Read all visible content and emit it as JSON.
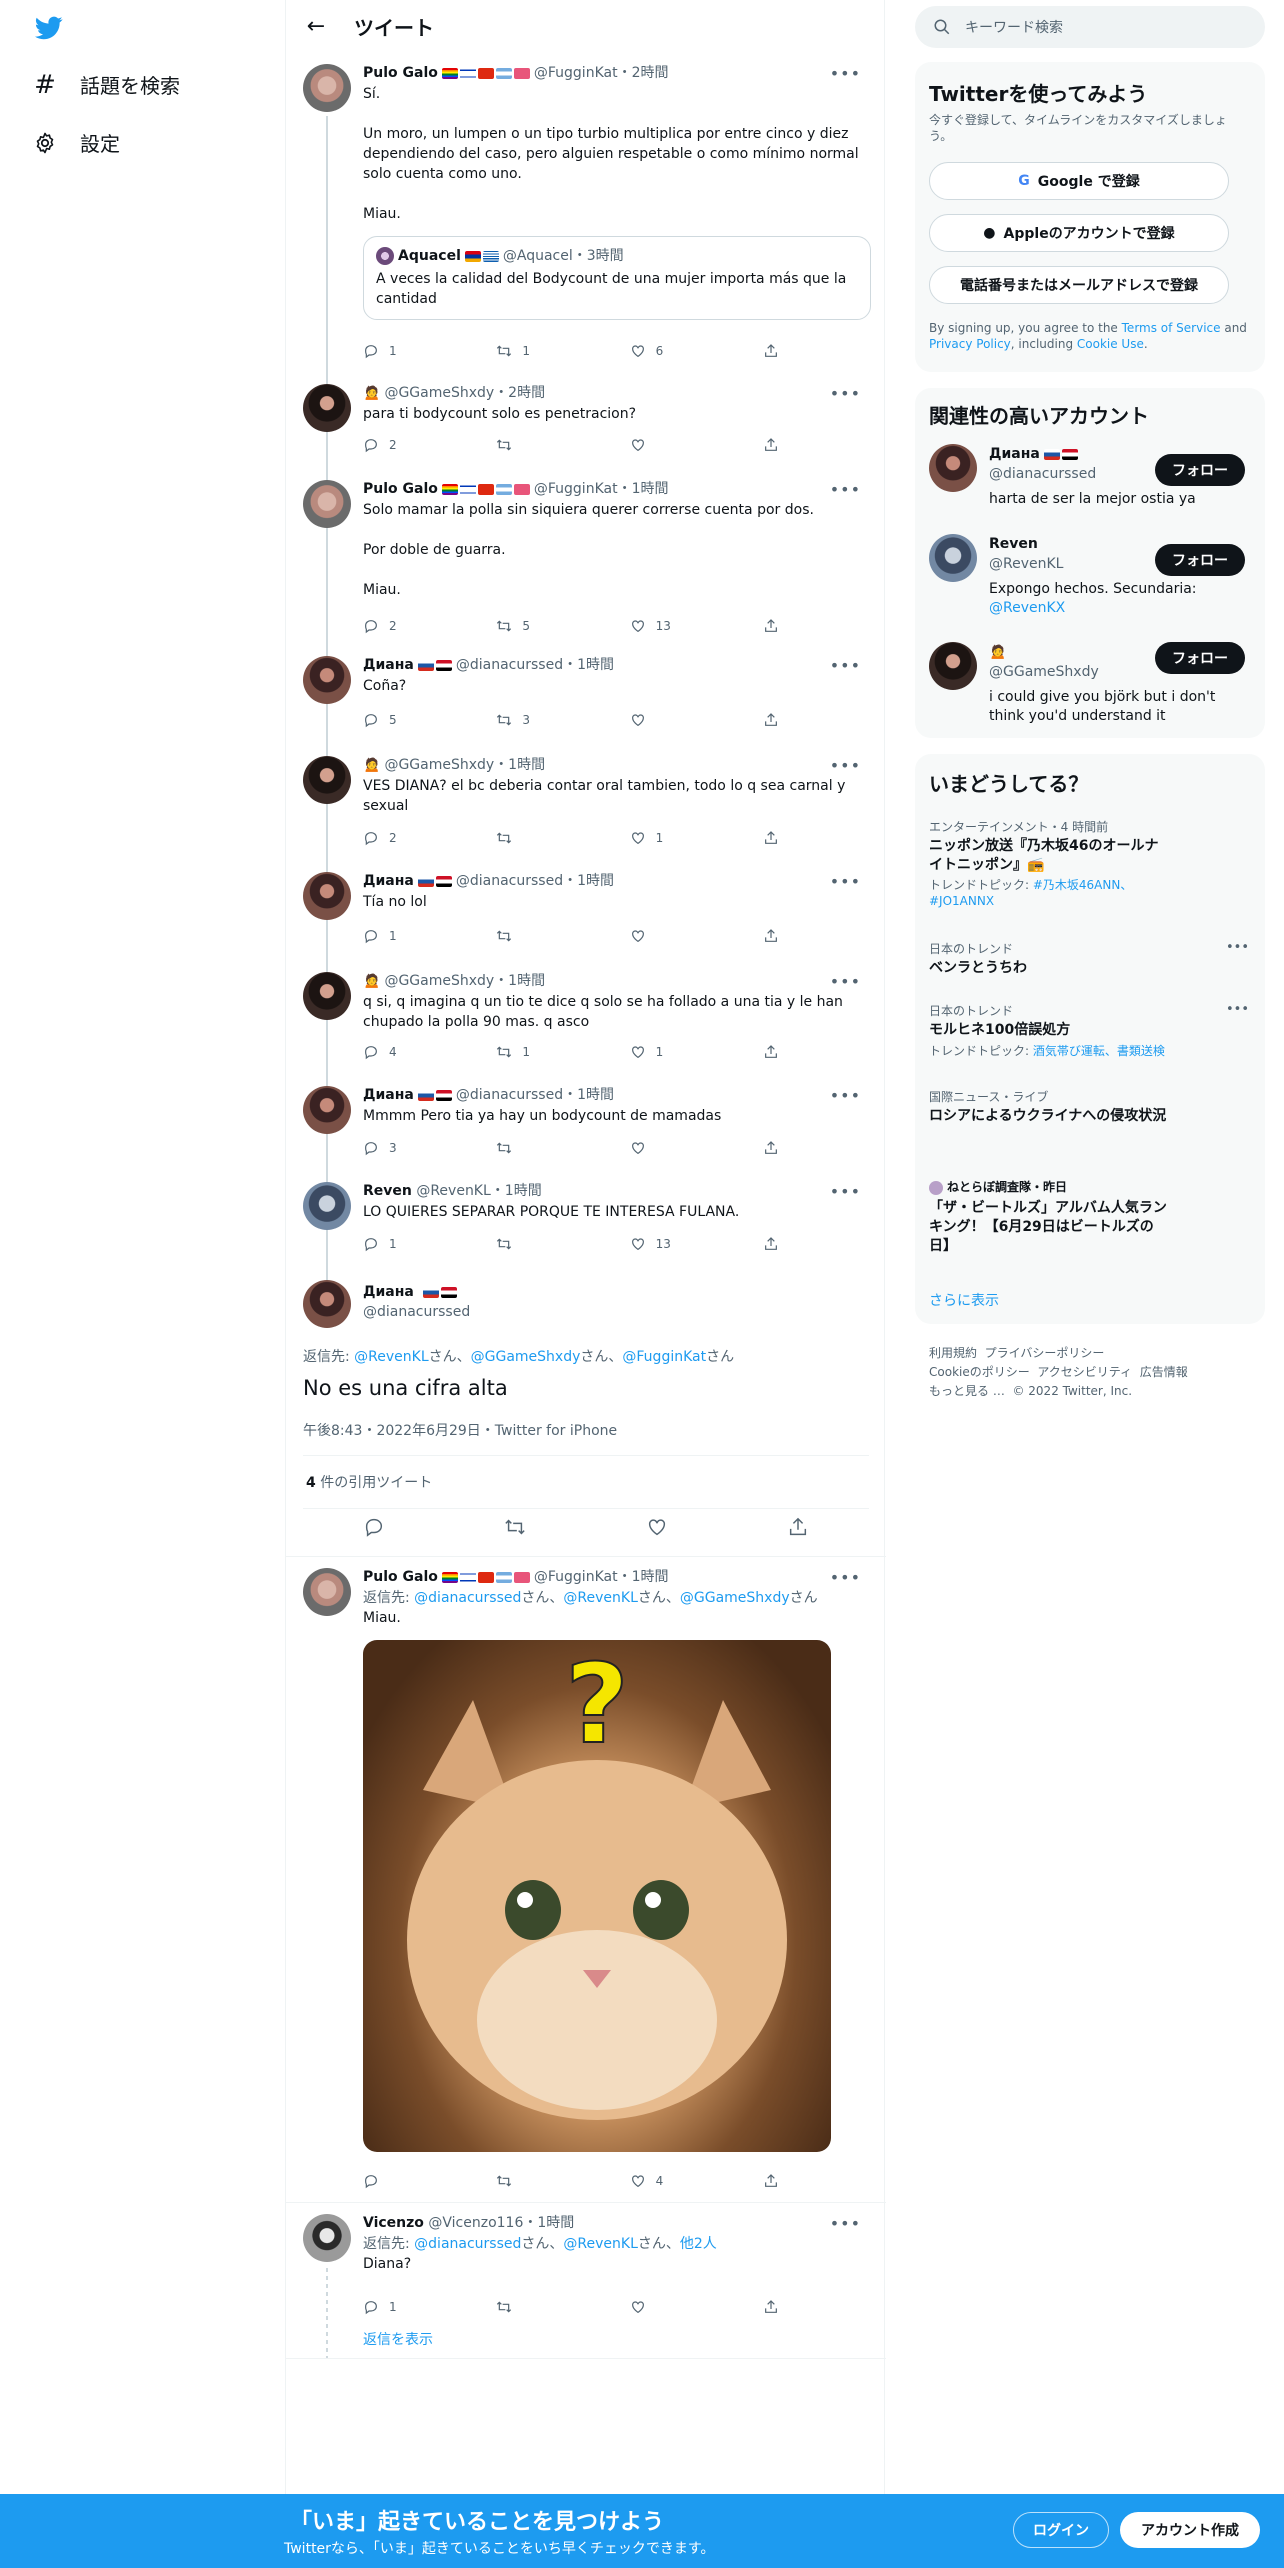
{
  "nav": {
    "explore": "話題を検索",
    "settings": "設定"
  },
  "header": {
    "title": "ツイート"
  },
  "search": {
    "placeholder": "キーワード検索"
  },
  "tweets": [
    {
      "name": "Pulo Galo",
      "handle": "@FugginKat",
      "time": "・2時間",
      "text": "Sí.\n\nUn moro, un lumpen o un tipo turbio multiplica por entre cinco y diez dependiendo del caso, pero alguien respetable o como mínimo normal solo cuenta como uno.\n\nMiau.",
      "reply": "1",
      "rt": "1",
      "like": "6"
    },
    {
      "name": "",
      "handle": "@GGameShxdy",
      "time": "・2時間",
      "text": "para ti bodycount solo es penetracion?",
      "reply": "2",
      "rt": "",
      "like": ""
    },
    {
      "name": "Pulo Galo",
      "handle": "@FugginKat",
      "time": "・1時間",
      "text": "Solo mamar la polla sin siquiera querer correrse cuenta por dos.\n\nPor doble de guarra.\n\nMiau.",
      "reply": "2",
      "rt": "5",
      "like": "13"
    },
    {
      "name": "Диана",
      "handle": "@dianacurssed",
      "time": "・1時間",
      "text": "Coña?",
      "reply": "5",
      "rt": "3",
      "like": ""
    },
    {
      "name": "",
      "handle": "@GGameShxdy",
      "time": "・1時間",
      "text": "VES DIANA? el bc deberia contar oral tambien, todo lo q sea carnal y sexual",
      "reply": "2",
      "rt": "",
      "like": "1"
    },
    {
      "name": "Диана",
      "handle": "@dianacurssed",
      "time": "・1時間",
      "text": "Tía no lol",
      "reply": "1",
      "rt": "",
      "like": ""
    },
    {
      "name": "",
      "handle": "@GGameShxdy",
      "time": "・1時間",
      "text": "q si, q imagina q un tio te dice q solo se ha follado a una tia y le han chupado la polla 90 mas. q asco",
      "reply": "4",
      "rt": "1",
      "like": "1"
    },
    {
      "name": "Диана",
      "handle": "@dianacurssed",
      "time": "・1時間",
      "text": "Mmmm Pero tia ya hay un bodycount de mamadas",
      "reply": "3",
      "rt": "",
      "like": ""
    },
    {
      "name": "Reven",
      "handle": "@RevenKL",
      "time": "・1時間",
      "text": "LO QUIERES SEPARAR PORQUE TE INTERESA FULANA.",
      "reply": "1",
      "rt": "",
      "like": "13"
    }
  ],
  "quote": {
    "name": "Aquacel",
    "handle": "@Aquacel",
    "time": "・3時間",
    "text": "A veces la calidad del Bodycount de una mujer importa más que la cantidad"
  },
  "main_tweet": {
    "name": "Диана",
    "handle": "@dianacurssed",
    "reply_prefix": "返信先: ",
    "reply_to": [
      {
        "handle": "@RevenKL",
        "suffix": "さん、"
      },
      {
        "handle": "@GGameShxdy",
        "suffix": "さん、"
      },
      {
        "handle": "@FugginKat",
        "suffix": "さん"
      }
    ],
    "text": "No es una cifra alta",
    "meta": "午後8:43・2022年6月29日・Twitter for iPhone",
    "quote_count": "4",
    "quote_label": " 件の引用ツイート"
  },
  "replies": [
    {
      "name": "Pulo Galo",
      "handle": "@FugginKat",
      "time": "・1時間",
      "reply_prefix": "返信先: ",
      "reply_to": [
        {
          "handle": "@dianacurssed",
          "suffix": "さん、"
        },
        {
          "handle": "@RevenKL",
          "suffix": "さん、"
        },
        {
          "handle": "@GGameShxdy",
          "suffix": "さん"
        }
      ],
      "text": "Miau.",
      "reply": "",
      "rt": "",
      "like": "4",
      "image_text": "?"
    },
    {
      "name": "Vicenzo",
      "handle": "@Vicenzo116",
      "time": "・1時間",
      "reply_prefix": "返信先: ",
      "reply_to": [
        {
          "handle": "@dianacurssed",
          "suffix": "さん、"
        },
        {
          "handle": "@RevenKL",
          "suffix": "さん、"
        },
        {
          "handle": "他2人",
          "suffix": ""
        }
      ],
      "text": "Diana?",
      "reply": "1",
      "rt": "",
      "like": ""
    }
  ],
  "show_replies": "返信を表示",
  "signup": {
    "title": "Twitterを使ってみよう",
    "subtitle": "今すぐ登録して、タイムラインをカスタマイズしましょう。",
    "google": "Google で登録",
    "apple": "Appleのアカウントで登録",
    "phone": "電話番号またはメールアドレスで登録",
    "legal_1": "By signing up, you agree to the ",
    "tos": "Terms of Service",
    "legal_2": " and ",
    "privacy": "Privacy Policy",
    "legal_3": ", including ",
    "cookie": "Cookie Use",
    "legal_4": "."
  },
  "relevant": {
    "title": "関連性の高いアカウント",
    "follow": "フォロー",
    "accounts": [
      {
        "name": "Диана",
        "handle": "@dianacurssed",
        "bio": "harta de ser la mejor ostia ya",
        "bio_link": ""
      },
      {
        "name": "Reven",
        "handle": "@RevenKL",
        "bio": "Expongo hechos. Secundaria: ",
        "bio_link": "@RevenKX"
      },
      {
        "name": "",
        "handle": "@GGameShxdy",
        "bio": "i could give you björk but i don't think you'd understand it",
        "bio_link": ""
      }
    ]
  },
  "trends": {
    "title": "いまどうしてる？",
    "items": [
      {
        "meta": "エンターテインメント・4 時間前",
        "title": "ニッポン放送『乃木坂46のオールナイトニッポン』📻",
        "sub_prefix": "トレンドトピック: ",
        "sub": "#乃木坂46ANN、#JO1ANNX"
      },
      {
        "meta": "日本のトレンド",
        "title": "ベンラとうちわ",
        "sub_prefix": "",
        "sub": ""
      },
      {
        "meta": "日本のトレンド",
        "title": "モルヒネ100倍誤処方",
        "sub_prefix": "トレンドトピック: ",
        "sub": "酒気帯び運転、書類送検"
      },
      {
        "meta": "国際ニュース・ライブ",
        "title": "ロシアによるウクライナへの侵攻状況",
        "sub_prefix": "",
        "sub": ""
      },
      {
        "meta": "ねとらぼ調査隊・昨日",
        "title": "「ザ・ビートルズ」アルバム人気ランキング！【6月29日はビートルズの日】",
        "sub_prefix": "",
        "sub": ""
      }
    ],
    "more": "さらに表示"
  },
  "footer": {
    "links": [
      "利用規約",
      "プライバシーポリシー",
      "Cookieのポリシー",
      "アクセシビリティ",
      "広告情報",
      "もっと見る …"
    ],
    "copyright": "© 2022 Twitter, Inc."
  },
  "bottom_bar": {
    "title": "「いま」起きていることを見つけよう",
    "subtitle": "Twitterなら、「いま」起きていることをいち早くチェックできます。",
    "login": "ログイン",
    "signup": "アカウント作成"
  },
  "colors": {
    "accent": "#1d9bf0",
    "text": "#0f1419",
    "muted": "#536471"
  }
}
